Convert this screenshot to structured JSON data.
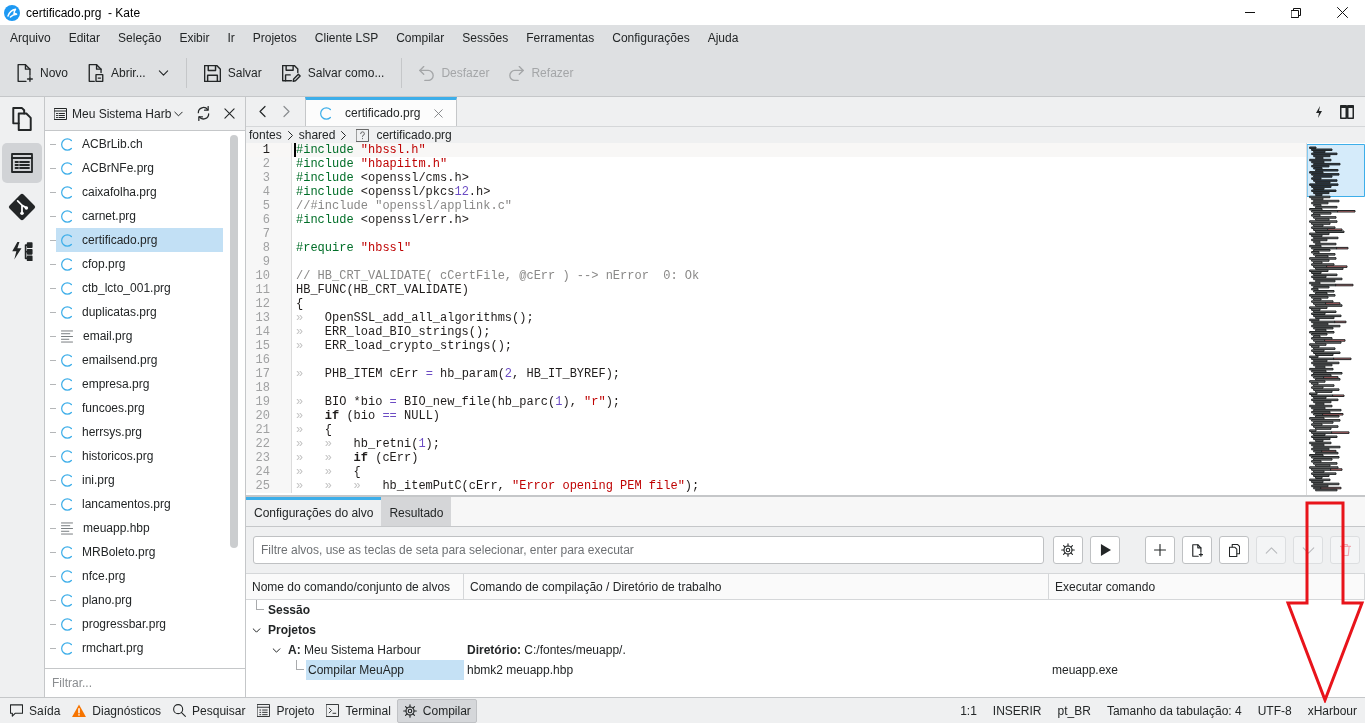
{
  "window": {
    "title": "certificado.prg  - Kate"
  },
  "menu": [
    "Arquivo",
    "Editar",
    "Seleção",
    "Exibir",
    "Ir",
    "Projetos",
    "Cliente LSP",
    "Compilar",
    "Sessões",
    "Ferramentas",
    "Configurações",
    "Ajuda"
  ],
  "toolbar": [
    [
      {
        "kind": "new",
        "label": "Novo",
        "disabled": false
      },
      {
        "kind": "open",
        "label": "Abrir...",
        "disabled": false,
        "dropdown": true
      }
    ],
    [
      {
        "kind": "save",
        "label": "Salvar",
        "disabled": false
      },
      {
        "kind": "save_as",
        "label": "Salvar como...",
        "disabled": false
      }
    ],
    [
      {
        "kind": "undo",
        "label": "Desfazer",
        "disabled": true
      },
      {
        "kind": "redo",
        "label": "Refazer",
        "disabled": true
      }
    ]
  ],
  "tool_sidebar": [
    {
      "kind": "documents",
      "selected": false
    },
    {
      "kind": "projects",
      "selected": true
    },
    {
      "kind": "git",
      "selected": false
    },
    {
      "kind": "symbols",
      "selected": false
    }
  ],
  "project_panel": {
    "title": "Meu Sistema Harb",
    "files": [
      {
        "name": "ACBrLib.ch",
        "kind": "c_source",
        "selected": false
      },
      {
        "name": "ACBrNFe.prg",
        "kind": "c_source",
        "selected": false
      },
      {
        "name": "caixafolha.prg",
        "kind": "c_source",
        "selected": false
      },
      {
        "name": "carnet.prg",
        "kind": "c_source",
        "selected": false
      },
      {
        "name": "certificado.prg",
        "kind": "c_source",
        "selected": true
      },
      {
        "name": "cfop.prg",
        "kind": "c_source",
        "selected": false
      },
      {
        "name": "ctb_lcto_001.prg",
        "kind": "c_source",
        "selected": false
      },
      {
        "name": "duplicatas.prg",
        "kind": "c_source",
        "selected": false
      },
      {
        "name": "email.prg",
        "kind": "text",
        "selected": false
      },
      {
        "name": "emailsend.prg",
        "kind": "c_source",
        "selected": false
      },
      {
        "name": "empresa.prg",
        "kind": "c_source",
        "selected": false
      },
      {
        "name": "funcoes.prg",
        "kind": "c_source",
        "selected": false
      },
      {
        "name": "herrsys.prg",
        "kind": "c_source",
        "selected": false
      },
      {
        "name": "historicos.prg",
        "kind": "c_source",
        "selected": false
      },
      {
        "name": "ini.prg",
        "kind": "c_source",
        "selected": false
      },
      {
        "name": "lancamentos.prg",
        "kind": "c_source",
        "selected": false
      },
      {
        "name": "meuapp.hbp",
        "kind": "text",
        "selected": false
      },
      {
        "name": "MRBoleto.prg",
        "kind": "c_source",
        "selected": false
      },
      {
        "name": "nfce.prg",
        "kind": "c_source",
        "selected": false
      },
      {
        "name": "plano.prg",
        "kind": "c_source",
        "selected": false
      },
      {
        "name": "progressbar.prg",
        "kind": "c_source",
        "selected": false
      },
      {
        "name": "rmchart.prg",
        "kind": "c_source",
        "selected": false
      }
    ],
    "filter": {
      "placeholder": "Filtrar..."
    }
  },
  "editor": {
    "tabs": [
      {
        "label": "certificado.prg",
        "selected": true
      }
    ],
    "breadcrumb": [
      {
        "label": "fontes",
        "kind": "folder"
      },
      {
        "label": "shared",
        "kind": "folder"
      },
      {
        "label": "certificado.prg",
        "kind": "file"
      }
    ],
    "lines": [
      {
        "number": "1",
        "current": true,
        "tokens": [
          {
            "kind": "preprocessor",
            "text": "#include "
          },
          {
            "kind": "string",
            "text": "\"hbssl.h\""
          }
        ]
      },
      {
        "number": "2",
        "current": false,
        "tokens": [
          {
            "kind": "preprocessor",
            "text": "#include "
          },
          {
            "kind": "string",
            "text": "\"hbapiitm.h\""
          }
        ]
      },
      {
        "number": "3",
        "current": false,
        "tokens": [
          {
            "kind": "preprocessor",
            "text": "#include"
          },
          {
            "kind": "plain",
            "text": " <openssl/cms.h>"
          }
        ]
      },
      {
        "number": "4",
        "current": false,
        "tokens": [
          {
            "kind": "preprocessor",
            "text": "#include"
          },
          {
            "kind": "plain",
            "text": " <openssl/pkcs"
          },
          {
            "kind": "number",
            "text": "12"
          },
          {
            "kind": "plain",
            "text": ".h>"
          }
        ]
      },
      {
        "number": "5",
        "current": false,
        "tokens": [
          {
            "kind": "comment",
            "text": "//#include \"openssl/applink.c\""
          }
        ]
      },
      {
        "number": "6",
        "current": false,
        "tokens": [
          {
            "kind": "preprocessor",
            "text": "#include"
          },
          {
            "kind": "plain",
            "text": " <openssl/err.h>"
          }
        ]
      },
      {
        "number": "7",
        "current": false
      },
      {
        "number": "8",
        "current": false,
        "tokens": [
          {
            "kind": "preprocessor",
            "text": "#require "
          },
          {
            "kind": "string",
            "text": "\"hbssl\""
          }
        ]
      },
      {
        "number": "9",
        "current": false
      },
      {
        "number": "10",
        "current": false,
        "tokens": [
          {
            "kind": "comment",
            "text": "// HB_CRT_VALIDATE( cCertFile, @cErr ) --> nError  0: Ok"
          }
        ]
      },
      {
        "number": "11",
        "current": false,
        "tokens": [
          {
            "kind": "plain",
            "text": "HB_FUNC(HB_CRT_VALIDATE)"
          }
        ]
      },
      {
        "number": "12",
        "current": false,
        "tokens": [
          {
            "kind": "plain",
            "text": "{"
          }
        ]
      },
      {
        "number": "13",
        "current": false,
        "tokens": [
          {
            "kind": "tab",
            "text": "»"
          },
          {
            "kind": "plain",
            "text": "OpenSSL_add_all_algorithms();"
          }
        ]
      },
      {
        "number": "14",
        "current": false,
        "tokens": [
          {
            "kind": "tab",
            "text": "»"
          },
          {
            "kind": "plain",
            "text": "ERR_load_BIO_strings();"
          }
        ]
      },
      {
        "number": "15",
        "current": false,
        "tokens": [
          {
            "kind": "tab",
            "text": "»"
          },
          {
            "kind": "plain",
            "text": "ERR_load_crypto_strings();"
          }
        ]
      },
      {
        "number": "16",
        "current": false
      },
      {
        "number": "17",
        "current": false,
        "tokens": [
          {
            "kind": "tab",
            "text": "»"
          },
          {
            "kind": "plain",
            "text": "PHB_ITEM cErr "
          },
          {
            "kind": "operator",
            "text": "="
          },
          {
            "kind": "plain",
            "text": " hb_param("
          },
          {
            "kind": "number",
            "text": "2"
          },
          {
            "kind": "plain",
            "text": ", HB_IT_BYREF);"
          }
        ]
      },
      {
        "number": "18",
        "current": false
      },
      {
        "number": "19",
        "current": false,
        "tokens": [
          {
            "kind": "tab",
            "text": "»"
          },
          {
            "kind": "plain",
            "text": "BIO *bio "
          },
          {
            "kind": "operator",
            "text": "="
          },
          {
            "kind": "plain",
            "text": " BIO_new_file(hb_parc("
          },
          {
            "kind": "number",
            "text": "1"
          },
          {
            "kind": "plain",
            "text": "), "
          },
          {
            "kind": "string",
            "text": "\"r\""
          },
          {
            "kind": "plain",
            "text": ");"
          }
        ]
      },
      {
        "number": "20",
        "current": false,
        "tokens": [
          {
            "kind": "tab",
            "text": "»"
          },
          {
            "kind": "keyword",
            "text": "if"
          },
          {
            "kind": "plain",
            "text": " (bio "
          },
          {
            "kind": "operator",
            "text": "=="
          },
          {
            "kind": "plain",
            "text": " NULL)"
          }
        ]
      },
      {
        "number": "21",
        "current": false,
        "tokens": [
          {
            "kind": "tab",
            "text": "»"
          },
          {
            "kind": "plain",
            "text": "{"
          }
        ]
      },
      {
        "number": "22",
        "current": false,
        "tokens": [
          {
            "kind": "tab",
            "text": "»"
          },
          {
            "kind": "tab",
            "text": "»"
          },
          {
            "kind": "plain",
            "text": "hb_retni("
          },
          {
            "kind": "number",
            "text": "1"
          },
          {
            "kind": "plain",
            "text": ");"
          }
        ]
      },
      {
        "number": "23",
        "current": false,
        "tokens": [
          {
            "kind": "tab",
            "text": "»"
          },
          {
            "kind": "tab",
            "text": "»"
          },
          {
            "kind": "keyword",
            "text": "if"
          },
          {
            "kind": "plain",
            "text": " (cErr)"
          }
        ]
      },
      {
        "number": "24",
        "current": false,
        "tokens": [
          {
            "kind": "tab",
            "text": "»"
          },
          {
            "kind": "tab",
            "text": "»"
          },
          {
            "kind": "plain",
            "text": "{"
          }
        ]
      },
      {
        "number": "25",
        "current": false,
        "tokens": [
          {
            "kind": "tab",
            "text": "»"
          },
          {
            "kind": "tab",
            "text": "»"
          },
          {
            "kind": "tab",
            "text": "»"
          },
          {
            "kind": "plain",
            "text": "hb_itemPutC(cErr, "
          },
          {
            "kind": "string",
            "text": "\"Error opening PEM file\""
          },
          {
            "kind": "plain",
            "text": ");"
          }
        ]
      }
    ]
  },
  "build_panel": {
    "tabs": [
      {
        "label": "Configurações do alvo",
        "selected": true
      },
      {
        "label": "Resultado",
        "selected": false
      }
    ],
    "filter": {
      "placeholder": "Filtre alvos, use as teclas de seta para selecionar, enter para executar"
    },
    "actions": [
      [
        {
          "kind": "settings",
          "disabled": false
        },
        {
          "kind": "run",
          "disabled": false
        }
      ],
      [
        {
          "kind": "add",
          "disabled": false
        },
        {
          "kind": "new_file",
          "disabled": false
        },
        {
          "kind": "copy",
          "disabled": false
        },
        {
          "kind": "up",
          "disabled": true
        },
        {
          "kind": "down",
          "disabled": true
        },
        {
          "kind": "delete",
          "disabled": true
        }
      ]
    ],
    "columns": [
      "Nome do comando/conjunto de alvos",
      "Comando de compilação / Diretório de trabalho",
      "Executar comando"
    ],
    "targets": [
      {
        "name": "Sessão",
        "selected": false
      },
      {
        "name": "Projetos",
        "selected": false,
        "expanded": true,
        "children": [
          {
            "name": "**A:** Meu Sistema Harbour",
            "detail": "**Diretório:** C:/fontes/meuapp/.",
            "selected": false,
            "expanded": true,
            "children": [
              {
                "name": "Compilar MeuApp",
                "command": "hbmk2 meuapp.hbp",
                "run_command": "meuapp.exe",
                "selected": true
              }
            ]
          }
        ]
      }
    ]
  },
  "status_bar": {
    "left": [
      {
        "kind": "output",
        "label": "Saída",
        "selected": false
      },
      {
        "kind": "diagnostics",
        "label": "Diagnósticos",
        "selected": false
      },
      {
        "kind": "search",
        "label": "Pesquisar",
        "selected": false
      },
      {
        "kind": "project",
        "label": "Projeto",
        "selected": false
      },
      {
        "kind": "terminal",
        "label": "Terminal",
        "selected": false
      },
      {
        "kind": "build",
        "label": "Compilar",
        "selected": true
      }
    ],
    "right": [
      "1:1",
      "INSERIR",
      "pt_BR",
      "Tamanho da tabulação: 4",
      "UTF-8",
      "xHarbour"
    ]
  }
}
